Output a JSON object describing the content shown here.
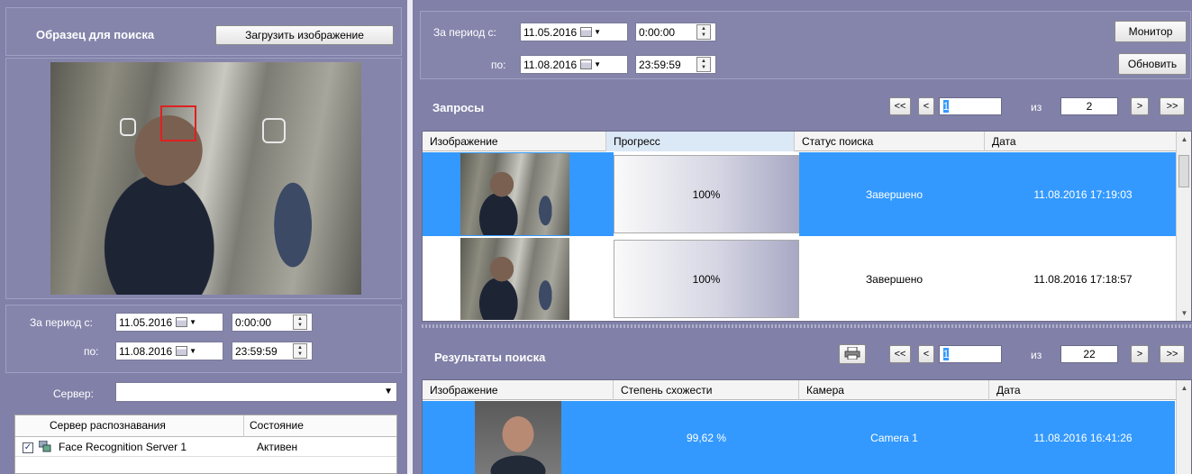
{
  "left": {
    "sample_title": "Образец для поиска",
    "load_button": "Загрузить изображение",
    "period_from_label": "За период с:",
    "period_to_label": "по:",
    "date_from": "11.05.2016",
    "time_from": "0:00:00",
    "date_to": "11.08.2016",
    "time_to": "23:59:59",
    "server_label": "Сервер:",
    "server_value": "",
    "server_table": {
      "columns": [
        "Сервер распознавания",
        "Состояние"
      ],
      "rows": [
        {
          "checked": true,
          "name": "Face Recognition Server 1",
          "state": "Активен"
        }
      ]
    }
  },
  "top": {
    "period_from_label": "За период с:",
    "period_to_label": "по:",
    "date_from": "11.05.2016",
    "time_from": "0:00:00",
    "date_to": "11.08.2016",
    "time_to": "23:59:59",
    "monitor_button": "Монитор",
    "refresh_button": "Обновить"
  },
  "requests": {
    "title": "Запросы",
    "pager": {
      "first": "<<",
      "prev": "<",
      "page": "1",
      "of": "из",
      "total": "2",
      "next": ">",
      "last": ">>"
    },
    "columns": [
      "Изображение",
      "Прогресс",
      "Статус поиска",
      "Дата"
    ],
    "rows": [
      {
        "progress": "100%",
        "progress_fraction": 1.0,
        "status": "Завершено",
        "date": "11.08.2016 17:19:03",
        "selected": true
      },
      {
        "progress": "100%",
        "progress_fraction": 1.0,
        "status": "Завершено",
        "date": "11.08.2016 17:18:57",
        "selected": false
      }
    ]
  },
  "results": {
    "title": "Результаты поиска",
    "pager": {
      "first": "<<",
      "prev": "<",
      "page": "1",
      "of": "из",
      "total": "22",
      "next": ">",
      "last": ">>"
    },
    "columns": [
      "Изображение",
      "Степень схожести",
      "Камера",
      "Дата"
    ],
    "rows": [
      {
        "similarity": "99,62 %",
        "camera": "Camera 1",
        "date": "11.08.2016 16:41:26",
        "selected": true
      }
    ]
  },
  "colors": {
    "panel": "#8080a8",
    "selection": "#3399ff",
    "face_box": "#e02020"
  }
}
